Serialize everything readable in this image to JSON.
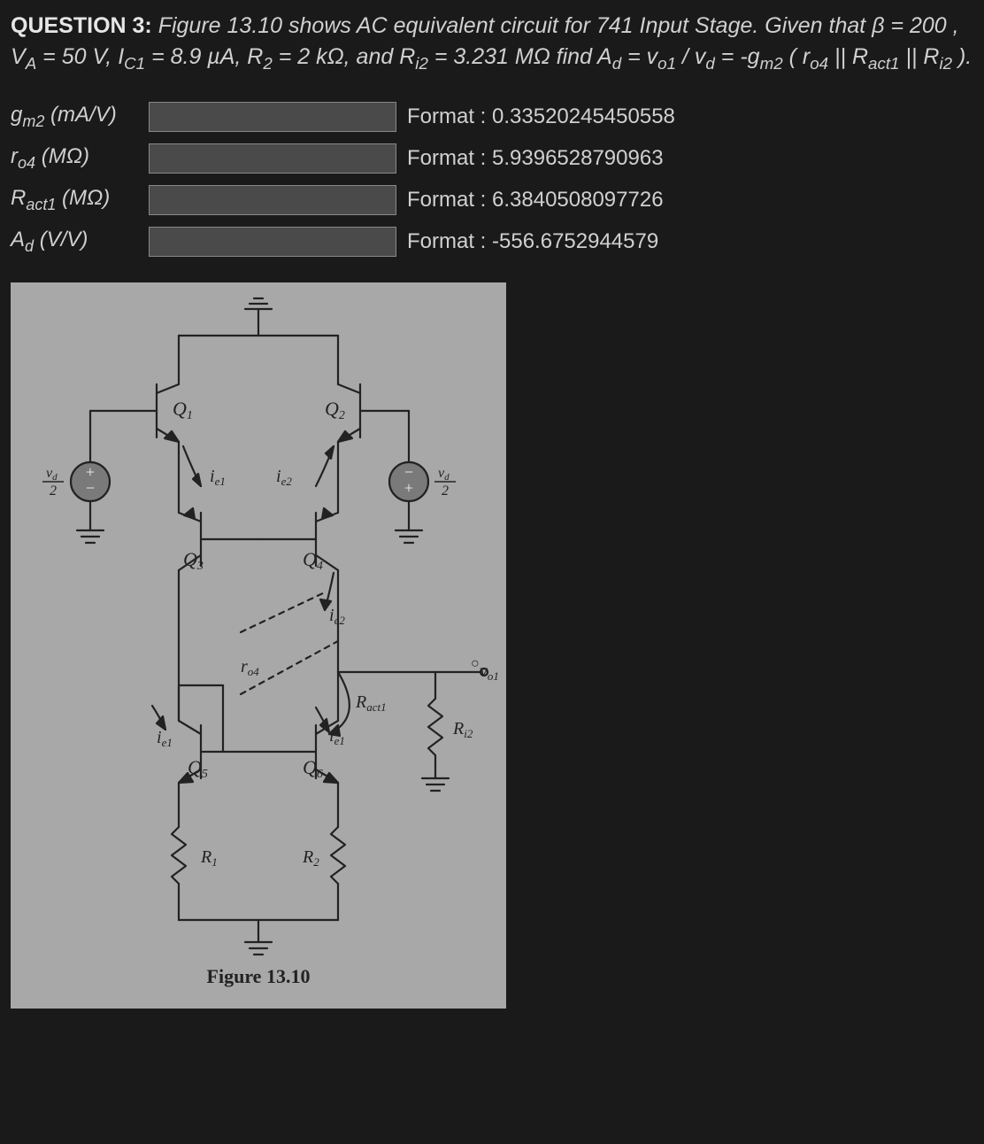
{
  "question": {
    "number_label": "QUESTION 3:",
    "figure_intro": "Figure 13.10 shows AC equivalent circuit for 741 Input Stage. Given that",
    "beta_sym": "β",
    "beta_val": "= 200 ,",
    "va_sym": "V",
    "va_sub": "A",
    "va_val": "= 50 V,",
    "ic1_sym": "I",
    "ic1_sub": "C1",
    "ic1_val": "= 8.9 µA,",
    "r2_sym": "R",
    "r2_sub": "2",
    "r2_val": "= 2 kΩ, and",
    "ri2_sym": "R",
    "ri2_sub": "i2",
    "ri2_val": "= 3.231 MΩ find",
    "ad_sym": "A",
    "ad_sub": "d",
    "ad_eq": "=",
    "vo1_sym": "v",
    "vo1_sub": "o1",
    "slash": "/",
    "vd_sym": "v",
    "vd_sub": "d",
    "eq2": "=",
    "neg": "-",
    "gm2_sym": "g",
    "gm2_sub": "m2",
    "open_par": "(",
    "ro4_sym": "r",
    "ro4_sub": "o4",
    "par1": "||",
    "ract1_sym": "R",
    "ract1_sub": "act1",
    "par2": "||",
    "rri2_sym": "R",
    "rri2_sub": "i2",
    "close_par": ")."
  },
  "answers": [
    {
      "label_sym": "g",
      "label_sub": "m2",
      "label_unit": "(mA/V)",
      "format": "Format : 0.33520245450558"
    },
    {
      "label_sym": "r",
      "label_sub": "o4",
      "label_unit": "(MΩ)",
      "format": "Format : 5.9396528790963"
    },
    {
      "label_sym": "R",
      "label_sub": "act1",
      "label_unit": "(MΩ)",
      "format": "Format : 6.3840508097726"
    },
    {
      "label_sym": "A",
      "label_sub": "d",
      "label_unit": "(V/V)",
      "format": "Format : -556.6752944579"
    }
  ],
  "figure": {
    "caption": "Figure 13.10",
    "labels": {
      "q1": "Q",
      "q1s": "1",
      "q2": "Q",
      "q2s": "2",
      "q3": "Q",
      "q3s": "3",
      "q4": "Q",
      "q4s": "4",
      "q5": "Q",
      "q5s": "5",
      "q6": "Q",
      "q6s": "6",
      "ie1": "i",
      "ie1s": "e1",
      "ie2": "i",
      "ie2s": "e2",
      "vd2": "v",
      "vd2s": "d",
      "vd2d": "2",
      "ro4": "r",
      "ro4s": "o4",
      "ract1": "R",
      "ract1s": "act1",
      "ri2": "R",
      "ri2s": "i2",
      "r1": "R",
      "r1s": "1",
      "r2": "R",
      "r2s": "2",
      "vo1": "v",
      "vo1s": "o1"
    }
  }
}
